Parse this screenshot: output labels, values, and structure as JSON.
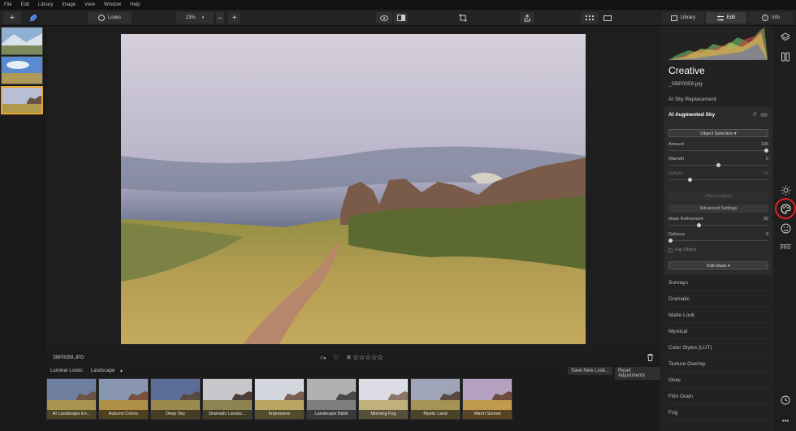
{
  "menu": [
    "File",
    "Edit",
    "Library",
    "Image",
    "View",
    "Window",
    "Help"
  ],
  "toolbar": {
    "add_icon": "plus-icon",
    "rocket_icon": "rocket-icon",
    "looks_label": "Looks",
    "zoom_value": "23%",
    "tabs": [
      "Library",
      "Edit",
      "Info"
    ]
  },
  "panel": {
    "title": "Creative",
    "filename": "_SBP0059.jpg",
    "sky_replacement": "AI Sky Replacement",
    "augmented_title": "AI Augmented Sky",
    "object_selection": "Object Selection ▾",
    "sliders": [
      {
        "label": "Amount",
        "value": "100",
        "level": 1.0
      },
      {
        "label": "Warmth",
        "value": "0",
        "level": 0.5
      },
      {
        "label": "Relight",
        "value": "20",
        "level": 0.2
      },
      {
        "label": "Mask Refinement",
        "value": "30",
        "level": 0.3
      },
      {
        "label": "Defocus",
        "value": "0",
        "level": 0.0
      }
    ],
    "place_object": "Place Object",
    "advanced_settings": "Advanced Settings",
    "flip_object": "Flip Object",
    "edit_mask": "Edit Mask ▾",
    "tools": [
      "Sunrays",
      "Dramatic",
      "Matte Look",
      "Mystical",
      "Color Styles (LUT)",
      "Texture Overlay",
      "Glow",
      "Film Grain",
      "Fog"
    ]
  },
  "side_icons": [
    "layers-icon",
    "compare-icon",
    "sun-icon",
    "palette-icon",
    "face-icon",
    "pro-icon",
    "clock-icon",
    "more-icon"
  ],
  "side_pro_label": "PRO",
  "infobar": {
    "filename": "SBP0059.JPG",
    "rating": "☆☆☆☆☆",
    "reject": "✕"
  },
  "looksbar": {
    "luminar_looks": "Luminar Looks:",
    "category": "Landscape",
    "save_new_look": "Save New Look...",
    "reset_adjustments": "Reset Adjustments"
  },
  "looks": [
    "AI Landscape En...",
    "Autumn Colors",
    "Deep Sky",
    "Dramatic Landsc...",
    "Impressive",
    "Landscape B&W",
    "Morning Fog",
    "Mystic Land",
    "Warm Sunset"
  ],
  "colors": {
    "accent": "#e7a52a",
    "highlight_ring": "#e02020"
  }
}
